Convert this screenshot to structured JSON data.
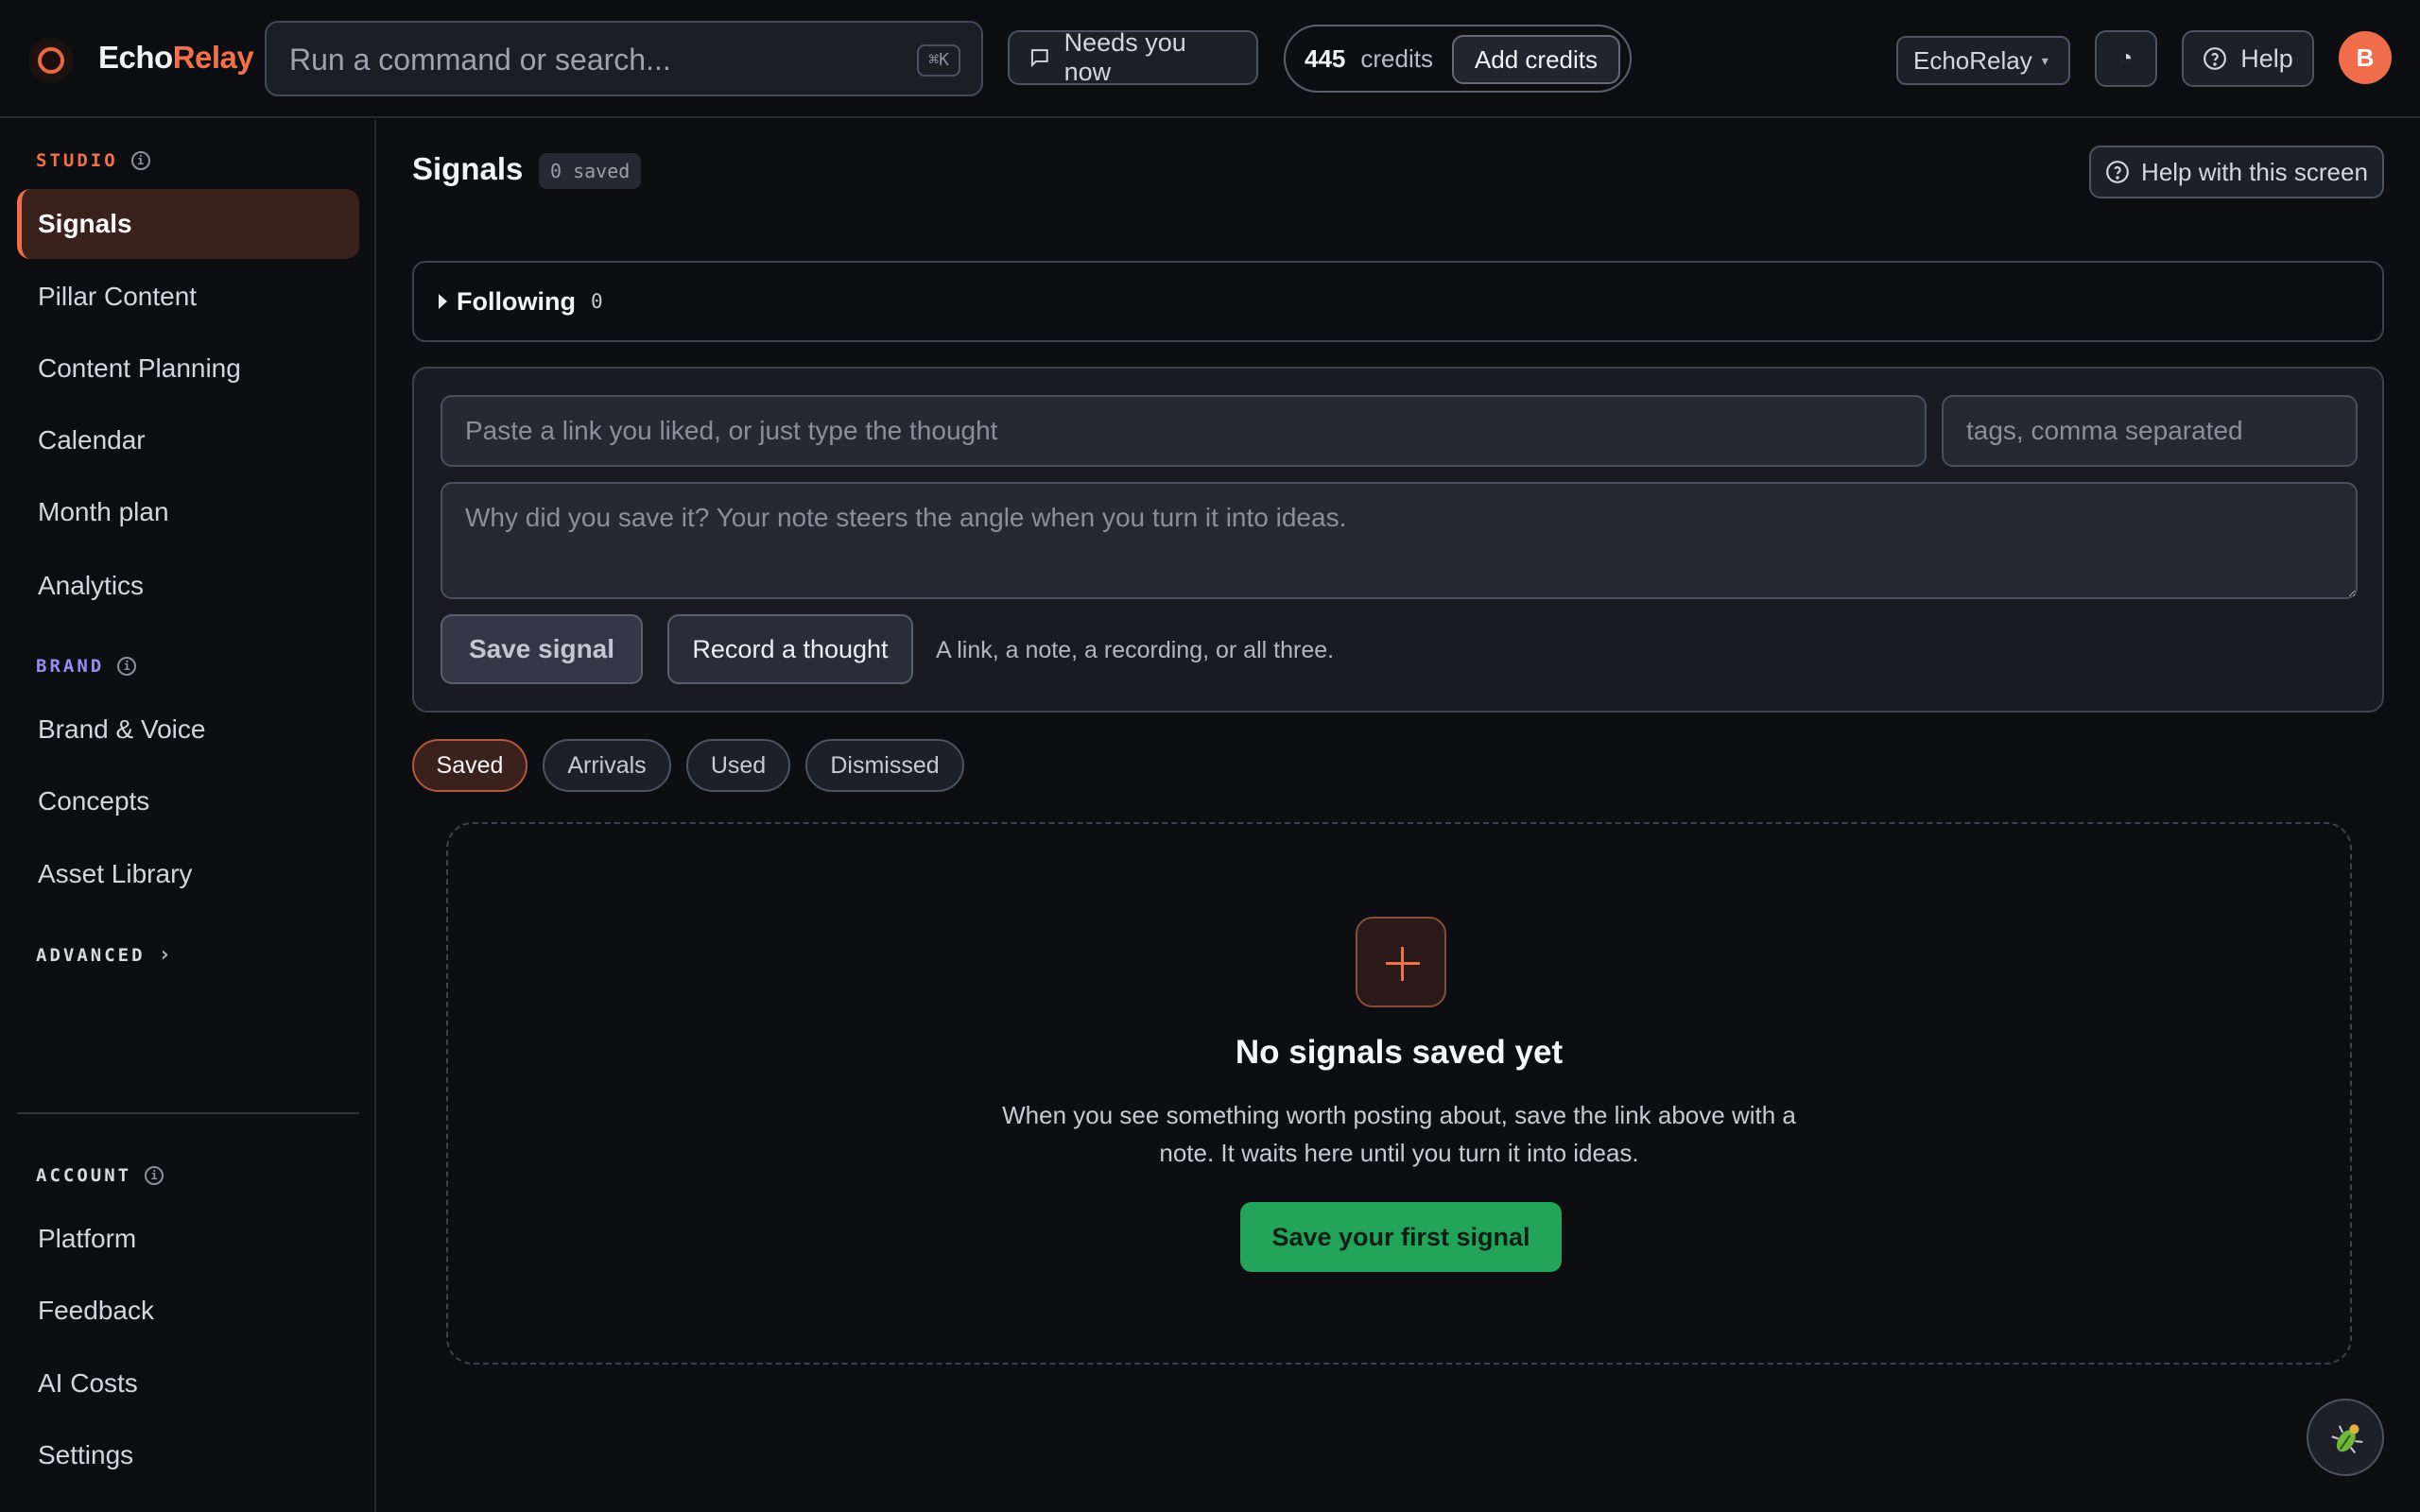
{
  "app": {
    "brand_part1": "Echo",
    "brand_part2": "Relay",
    "accent_color": "#ef6d4a",
    "success_color": "#22a55a"
  },
  "topbar": {
    "search_placeholder": "Run a command or search...",
    "search_shortcut": "⌘K",
    "needs_label": "Needs you now",
    "credits_count": "445",
    "credits_label": "credits",
    "add_credits_label": "Add credits",
    "workspace_label": "EchoRelay",
    "theme_icon": "◔",
    "help_label": "Help",
    "avatar_initial": "B"
  },
  "sidebar": {
    "studio_label": "STUDIO",
    "studio_items": [
      "Signals",
      "Pillar Content",
      "Content Planning",
      "Calendar",
      "Month plan",
      "Analytics"
    ],
    "brand_label": "BRAND",
    "brand_items": [
      "Brand & Voice",
      "Concepts",
      "Asset Library"
    ],
    "advanced_label": "ADVANCED",
    "advanced_chevron": "›",
    "account_label": "ACCOUNT",
    "account_items": [
      "Platform",
      "Feedback",
      "AI Costs",
      "Settings"
    ],
    "active_item": "Signals"
  },
  "main": {
    "title": "Signals",
    "saved_badge": "0 saved",
    "help_screen_label": "Help with this screen",
    "following_label": "Following",
    "following_count": "0",
    "composer": {
      "link_placeholder": "Paste a link you liked, or just type the thought",
      "tags_placeholder": "tags, comma separated",
      "note_placeholder": "Why did you save it? Your note steers the angle when you turn it into ideas.",
      "save_label": "Save signal",
      "record_label": "Record a thought",
      "hint": "A link, a note, a recording, or all three."
    },
    "tabs": [
      "Saved",
      "Arrivals",
      "Used",
      "Dismissed"
    ],
    "active_tab": "Saved",
    "empty": {
      "title": "No signals saved yet",
      "text": "When you see something worth posting about, save the link above with a note. It waits here until you turn it into ideas.",
      "cta_label": "Save your first signal"
    }
  }
}
